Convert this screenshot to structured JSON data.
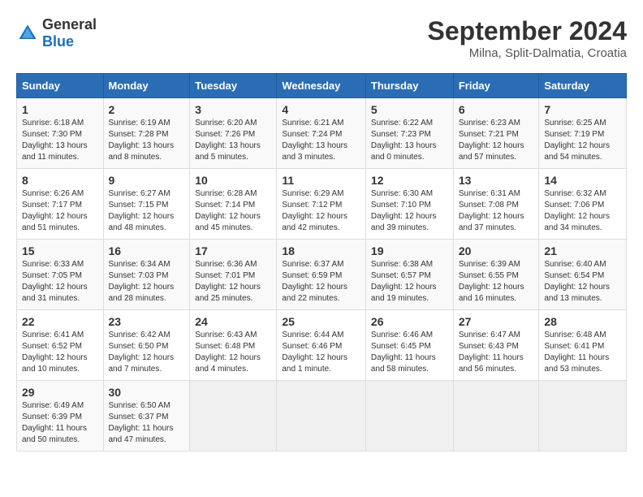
{
  "header": {
    "logo_general": "General",
    "logo_blue": "Blue",
    "month_year": "September 2024",
    "location": "Milna, Split-Dalmatia, Croatia"
  },
  "columns": [
    "Sunday",
    "Monday",
    "Tuesday",
    "Wednesday",
    "Thursday",
    "Friday",
    "Saturday"
  ],
  "weeks": [
    [
      {
        "day": "1",
        "sunrise": "Sunrise: 6:18 AM",
        "sunset": "Sunset: 7:30 PM",
        "daylight": "Daylight: 13 hours and 11 minutes."
      },
      {
        "day": "2",
        "sunrise": "Sunrise: 6:19 AM",
        "sunset": "Sunset: 7:28 PM",
        "daylight": "Daylight: 13 hours and 8 minutes."
      },
      {
        "day": "3",
        "sunrise": "Sunrise: 6:20 AM",
        "sunset": "Sunset: 7:26 PM",
        "daylight": "Daylight: 13 hours and 5 minutes."
      },
      {
        "day": "4",
        "sunrise": "Sunrise: 6:21 AM",
        "sunset": "Sunset: 7:24 PM",
        "daylight": "Daylight: 13 hours and 3 minutes."
      },
      {
        "day": "5",
        "sunrise": "Sunrise: 6:22 AM",
        "sunset": "Sunset: 7:23 PM",
        "daylight": "Daylight: 13 hours and 0 minutes."
      },
      {
        "day": "6",
        "sunrise": "Sunrise: 6:23 AM",
        "sunset": "Sunset: 7:21 PM",
        "daylight": "Daylight: 12 hours and 57 minutes."
      },
      {
        "day": "7",
        "sunrise": "Sunrise: 6:25 AM",
        "sunset": "Sunset: 7:19 PM",
        "daylight": "Daylight: 12 hours and 54 minutes."
      }
    ],
    [
      {
        "day": "8",
        "sunrise": "Sunrise: 6:26 AM",
        "sunset": "Sunset: 7:17 PM",
        "daylight": "Daylight: 12 hours and 51 minutes."
      },
      {
        "day": "9",
        "sunrise": "Sunrise: 6:27 AM",
        "sunset": "Sunset: 7:15 PM",
        "daylight": "Daylight: 12 hours and 48 minutes."
      },
      {
        "day": "10",
        "sunrise": "Sunrise: 6:28 AM",
        "sunset": "Sunset: 7:14 PM",
        "daylight": "Daylight: 12 hours and 45 minutes."
      },
      {
        "day": "11",
        "sunrise": "Sunrise: 6:29 AM",
        "sunset": "Sunset: 7:12 PM",
        "daylight": "Daylight: 12 hours and 42 minutes."
      },
      {
        "day": "12",
        "sunrise": "Sunrise: 6:30 AM",
        "sunset": "Sunset: 7:10 PM",
        "daylight": "Daylight: 12 hours and 39 minutes."
      },
      {
        "day": "13",
        "sunrise": "Sunrise: 6:31 AM",
        "sunset": "Sunset: 7:08 PM",
        "daylight": "Daylight: 12 hours and 37 minutes."
      },
      {
        "day": "14",
        "sunrise": "Sunrise: 6:32 AM",
        "sunset": "Sunset: 7:06 PM",
        "daylight": "Daylight: 12 hours and 34 minutes."
      }
    ],
    [
      {
        "day": "15",
        "sunrise": "Sunrise: 6:33 AM",
        "sunset": "Sunset: 7:05 PM",
        "daylight": "Daylight: 12 hours and 31 minutes."
      },
      {
        "day": "16",
        "sunrise": "Sunrise: 6:34 AM",
        "sunset": "Sunset: 7:03 PM",
        "daylight": "Daylight: 12 hours and 28 minutes."
      },
      {
        "day": "17",
        "sunrise": "Sunrise: 6:36 AM",
        "sunset": "Sunset: 7:01 PM",
        "daylight": "Daylight: 12 hours and 25 minutes."
      },
      {
        "day": "18",
        "sunrise": "Sunrise: 6:37 AM",
        "sunset": "Sunset: 6:59 PM",
        "daylight": "Daylight: 12 hours and 22 minutes."
      },
      {
        "day": "19",
        "sunrise": "Sunrise: 6:38 AM",
        "sunset": "Sunset: 6:57 PM",
        "daylight": "Daylight: 12 hours and 19 minutes."
      },
      {
        "day": "20",
        "sunrise": "Sunrise: 6:39 AM",
        "sunset": "Sunset: 6:55 PM",
        "daylight": "Daylight: 12 hours and 16 minutes."
      },
      {
        "day": "21",
        "sunrise": "Sunrise: 6:40 AM",
        "sunset": "Sunset: 6:54 PM",
        "daylight": "Daylight: 12 hours and 13 minutes."
      }
    ],
    [
      {
        "day": "22",
        "sunrise": "Sunrise: 6:41 AM",
        "sunset": "Sunset: 6:52 PM",
        "daylight": "Daylight: 12 hours and 10 minutes."
      },
      {
        "day": "23",
        "sunrise": "Sunrise: 6:42 AM",
        "sunset": "Sunset: 6:50 PM",
        "daylight": "Daylight: 12 hours and 7 minutes."
      },
      {
        "day": "24",
        "sunrise": "Sunrise: 6:43 AM",
        "sunset": "Sunset: 6:48 PM",
        "daylight": "Daylight: 12 hours and 4 minutes."
      },
      {
        "day": "25",
        "sunrise": "Sunrise: 6:44 AM",
        "sunset": "Sunset: 6:46 PM",
        "daylight": "Daylight: 12 hours and 1 minute."
      },
      {
        "day": "26",
        "sunrise": "Sunrise: 6:46 AM",
        "sunset": "Sunset: 6:45 PM",
        "daylight": "Daylight: 11 hours and 58 minutes."
      },
      {
        "day": "27",
        "sunrise": "Sunrise: 6:47 AM",
        "sunset": "Sunset: 6:43 PM",
        "daylight": "Daylight: 11 hours and 56 minutes."
      },
      {
        "day": "28",
        "sunrise": "Sunrise: 6:48 AM",
        "sunset": "Sunset: 6:41 PM",
        "daylight": "Daylight: 11 hours and 53 minutes."
      }
    ],
    [
      {
        "day": "29",
        "sunrise": "Sunrise: 6:49 AM",
        "sunset": "Sunset: 6:39 PM",
        "daylight": "Daylight: 11 hours and 50 minutes."
      },
      {
        "day": "30",
        "sunrise": "Sunrise: 6:50 AM",
        "sunset": "Sunset: 6:37 PM",
        "daylight": "Daylight: 11 hours and 47 minutes."
      },
      null,
      null,
      null,
      null,
      null
    ]
  ]
}
